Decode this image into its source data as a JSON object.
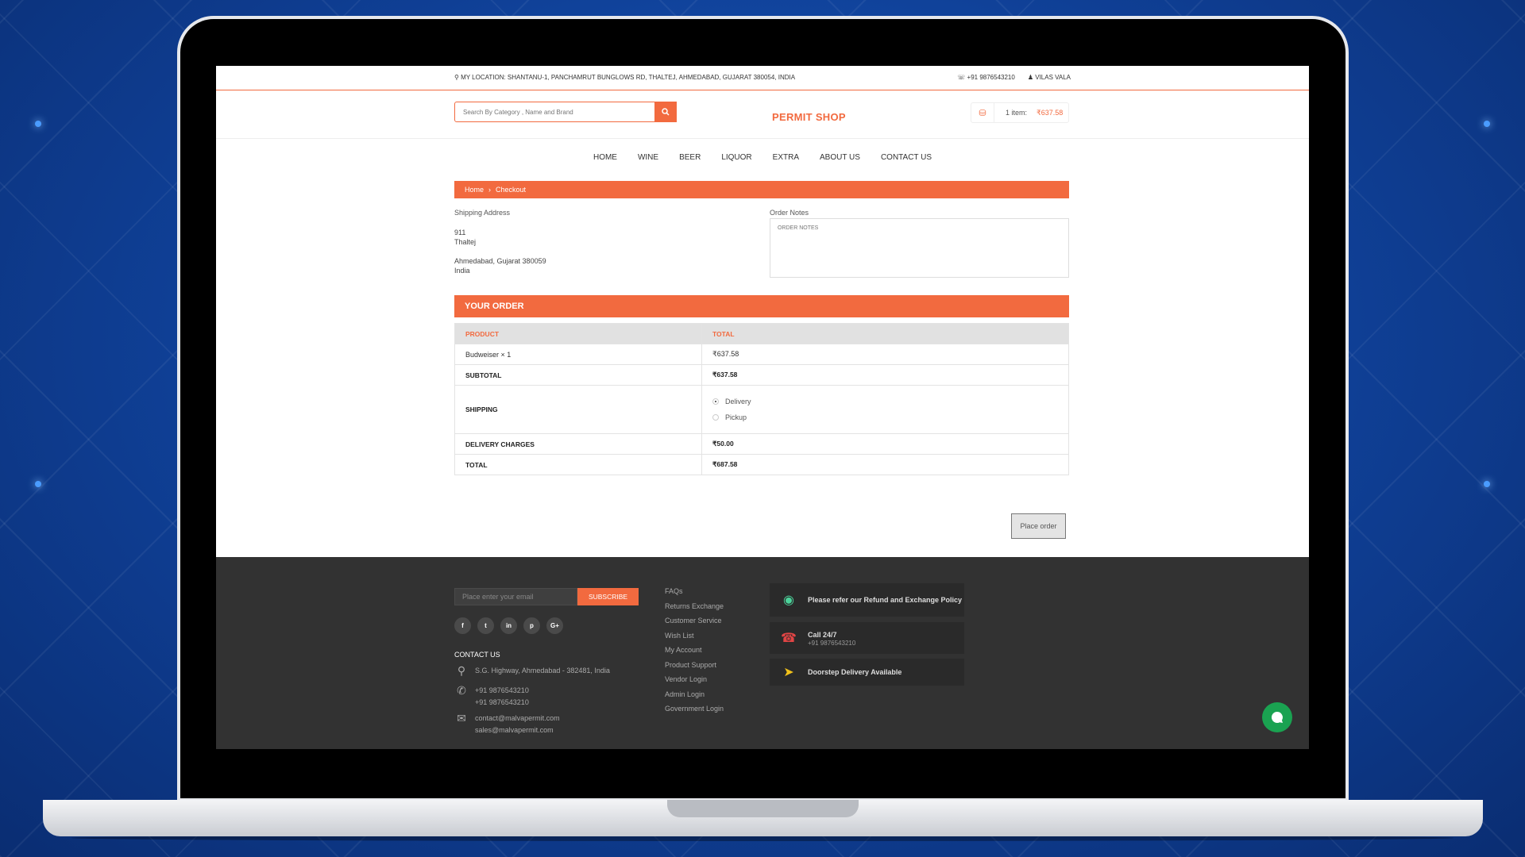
{
  "topbar": {
    "location": "MY LOCATION: SHANTANU-1, PANCHAMRUT BUNGLOWS RD, THALTEJ, AHMEDABAD, GUJARAT 380054, INDIA",
    "phone": "+91 9876543210",
    "user": "VILAS VALA"
  },
  "header": {
    "search_placeholder": "Search By Category , Name and Brand",
    "logo": "PERMIT SHOP",
    "cart_items": "1 item:",
    "cart_price": "₹637.58"
  },
  "nav": [
    "HOME",
    "WINE",
    "BEER",
    "LIQUOR",
    "EXTRA",
    "ABOUT US",
    "CONTACT US"
  ],
  "breadcrumb": {
    "home": "Home",
    "current": "Checkout"
  },
  "shipping": {
    "label": "Shipping Address",
    "line1": "911",
    "line2": "Thaltej",
    "line3": "Ahmedabad, Gujarat 380059",
    "line4": "India"
  },
  "notes": {
    "label": "Order Notes",
    "placeholder": "ORDER NOTES"
  },
  "order": {
    "heading": "YOUR ORDER",
    "col_product": "PRODUCT",
    "col_total": "TOTAL",
    "item_name": "Budweiser  × 1",
    "item_total": "₹637.58",
    "subtotal_label": "SUBTOTAL",
    "subtotal": "₹637.58",
    "shipping_label": "SHIPPING",
    "shipping_options": [
      "Delivery",
      "Pickup"
    ],
    "selected_shipping": "Delivery",
    "delivery_label": "DELIVERY CHARGES",
    "delivery": "₹50.00",
    "total_label": "TOTAL",
    "total": "₹687.58"
  },
  "place_order": "Place order",
  "footer": {
    "email_placeholder": "Place enter your email",
    "subscribe": "SUBSCRIBE",
    "contact_title": "CONTACT US",
    "address": "S.G. Highway, Ahmedabad - 382481, India",
    "phone1": "+91 9876543210",
    "phone2": "+91 9876543210",
    "email1": "contact@malvapermit.com",
    "email2": "sales@malvapermit.com",
    "links": [
      "FAQs",
      "Returns Exchange",
      "Customer Service",
      "Wish List",
      "My Account",
      "Product Support",
      "Vendor Login",
      "Admin Login",
      "Government Login"
    ],
    "info1": "Please refer our Refund and Exchange Policy",
    "info2_title": "Call 24/7",
    "info2_sub": "+91 9876543210",
    "info3": "Doorstep Delivery Available"
  },
  "colors": {
    "accent": "#f26a3f",
    "footer_bg": "#323232",
    "chat": "#1aa251"
  }
}
